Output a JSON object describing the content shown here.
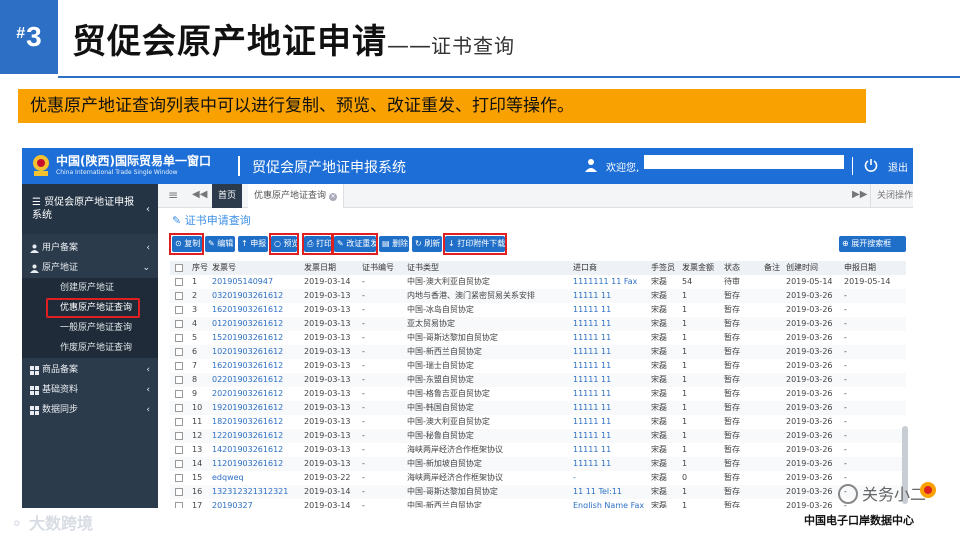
{
  "slide": {
    "number_hash": "#",
    "number": "3",
    "title": "贸促会原产地证申请",
    "dash": "——",
    "subtitle": "证书查询",
    "banner": "优惠原产地证查询列表中可以进行复制、预览、改证重发、打印等操作。"
  },
  "header": {
    "logo_title": "中国(陕西)国际贸易单一窗口",
    "logo_sub": "China International Trade Single Window",
    "system_title": "贸促会原产地证申报系统",
    "welcome": "欢迎您,",
    "logout": "退出"
  },
  "sidebar": {
    "head": "贸促会原产地证申报系统",
    "items": [
      {
        "label": "用户备案"
      },
      {
        "label": "原产地证"
      },
      {
        "label": "商品备案"
      },
      {
        "label": "基础资料"
      },
      {
        "label": "数据同步"
      }
    ],
    "sub_items": [
      {
        "label": "创建原产地证"
      },
      {
        "label": "优惠原产地证查询"
      },
      {
        "label": "一般原产地证查询"
      },
      {
        "label": "作废原产地证查询"
      }
    ]
  },
  "tabs": {
    "home": "首页",
    "current": "优惠原产地证查询",
    "close_ops": "关闭操作"
  },
  "content_title": "证书申请查询",
  "toolbar": {
    "copy": "复制",
    "edit": "编辑",
    "declare": "申报",
    "preview": "预览",
    "print": "打印",
    "reissue": "改证重发",
    "delete": "删除",
    "refresh": "刷新",
    "print_attachment": "打印附件下载",
    "expand_search": "展开搜索框"
  },
  "table": {
    "headers": [
      "序号",
      "发票号",
      "发票日期",
      "证书编号",
      "证书类型",
      "进口商",
      "手签员",
      "发票金额",
      "状态",
      "备注",
      "创建时间",
      "申报日期"
    ],
    "rows": [
      [
        "1",
        "201905140947",
        "2019-03-14",
        "-",
        "中国-澳大利亚自贸协定",
        "1111111 11 Fax",
        "宋磊",
        "54",
        "待审",
        "",
        "2019-05-14",
        "2019-05-14"
      ],
      [
        "2",
        "03201903261612",
        "2019-03-13",
        "-",
        "内地与香港、澳门紧密贸易关系安排",
        "11111 11",
        "宋磊",
        "1",
        "暂存",
        "",
        "2019-03-26",
        "-"
      ],
      [
        "3",
        "16201903261612",
        "2019-03-13",
        "-",
        "中国-冰岛自贸协定",
        "11111 11",
        "宋磊",
        "1",
        "暂存",
        "",
        "2019-03-26",
        "-"
      ],
      [
        "4",
        "01201903261612",
        "2019-03-13",
        "-",
        "亚太贸易协定",
        "11111 11",
        "宋磊",
        "1",
        "暂存",
        "",
        "2019-03-26",
        "-"
      ],
      [
        "5",
        "15201903261612",
        "2019-03-13",
        "-",
        "中国-哥斯达黎加自贸协定",
        "11111 11",
        "宋磊",
        "1",
        "暂存",
        "",
        "2019-03-26",
        "-"
      ],
      [
        "6",
        "10201903261612",
        "2019-03-13",
        "-",
        "中国-新西兰自贸协定",
        "11111 11",
        "宋磊",
        "1",
        "暂存",
        "",
        "2019-03-26",
        "-"
      ],
      [
        "7",
        "16201903261612",
        "2019-03-13",
        "-",
        "中国-瑞士自贸协定",
        "11111 11",
        "宋磊",
        "1",
        "暂存",
        "",
        "2019-03-26",
        "-"
      ],
      [
        "8",
        "02201903261612",
        "2019-03-13",
        "-",
        "中国-东盟自贸协定",
        "11111 11",
        "宋磊",
        "1",
        "暂存",
        "",
        "2019-03-26",
        "-"
      ],
      [
        "9",
        "20201903261612",
        "2019-03-13",
        "-",
        "中国-格鲁吉亚自贸协定",
        "11111 11",
        "宋磊",
        "1",
        "暂存",
        "",
        "2019-03-26",
        "-"
      ],
      [
        "10",
        "19201903261612",
        "2019-03-13",
        "-",
        "中国-韩国自贸协定",
        "11111 11",
        "宋磊",
        "1",
        "暂存",
        "",
        "2019-03-26",
        "-"
      ],
      [
        "11",
        "18201903261612",
        "2019-03-13",
        "-",
        "中国-澳大利亚自贸协定",
        "11111 11",
        "宋磊",
        "1",
        "暂存",
        "",
        "2019-03-26",
        "-"
      ],
      [
        "12",
        "12201903261612",
        "2019-03-13",
        "-",
        "中国-秘鲁自贸协定",
        "11111 11",
        "宋磊",
        "1",
        "暂存",
        "",
        "2019-03-26",
        "-"
      ],
      [
        "13",
        "14201903261612",
        "2019-03-13",
        "-",
        "海峡两岸经济合作框架协议",
        "11111 11",
        "宋磊",
        "1",
        "暂存",
        "",
        "2019-03-26",
        "-"
      ],
      [
        "14",
        "11201903261612",
        "2019-03-13",
        "-",
        "中国-新加坡自贸协定",
        "11111 11",
        "宋磊",
        "1",
        "暂存",
        "",
        "2019-03-26",
        "-"
      ],
      [
        "15",
        "edqweq",
        "2019-03-22",
        "-",
        "海峡两岸经济合作框架协议",
        "-",
        "宋磊",
        "0",
        "暂存",
        "",
        "2019-03-26",
        "-"
      ],
      [
        "16",
        "132312321312321",
        "2019-03-14",
        "-",
        "中国-哥斯达黎加自贸协定",
        "11 11 Tel:11",
        "宋磊",
        "1",
        "暂存",
        "",
        "2019-03-26",
        "-"
      ],
      [
        "17",
        "20190327",
        "2019-03-14",
        "-",
        "中国-新西兰自贸协定",
        "English Name Fax",
        "宋磊",
        "1",
        "暂存",
        "",
        "2019-03-26",
        "-"
      ]
    ]
  },
  "watermarks": {
    "left": "大数跨境",
    "right_brand": "关务小二",
    "right": "中国电子口岸数据中心"
  },
  "colors": {
    "accent": "#2d6fc4",
    "banner": "#f8a100",
    "topbar": "#1d6ed6",
    "sidebar": "#2c3b4c",
    "highlight": "#e02020"
  }
}
